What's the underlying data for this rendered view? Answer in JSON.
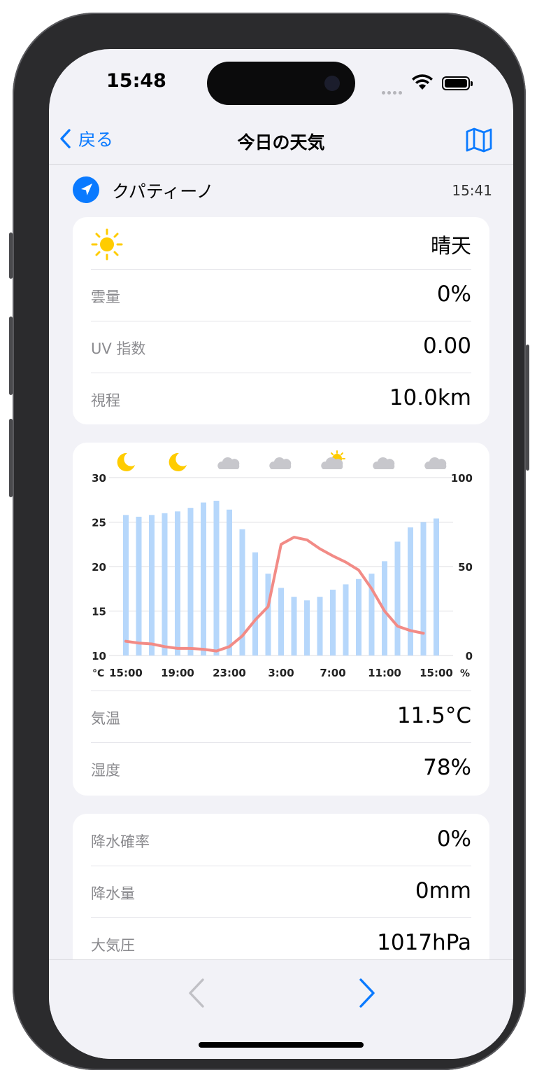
{
  "status": {
    "time": "15:48"
  },
  "nav": {
    "back_label": "戻る",
    "title": "今日の天気"
  },
  "location": {
    "name": "クパティーノ",
    "updated": "15:41"
  },
  "current": {
    "condition": "晴天",
    "rows": [
      {
        "label": "雲量",
        "value": "0%"
      },
      {
        "label": "UV 指数",
        "value": "0.00"
      },
      {
        "label": "視程",
        "value": "10.0km"
      }
    ]
  },
  "chart_data": {
    "type": "bar",
    "left_axis": {
      "unit": "°C",
      "ticks": [
        "30",
        "25",
        "20",
        "15",
        "10"
      ],
      "ylim": [
        10,
        30
      ]
    },
    "right_axis": {
      "unit": "%",
      "ticks": [
        "100",
        "50",
        "0"
      ],
      "ylim": [
        0,
        100
      ]
    },
    "x_tick_labels": [
      "15:00",
      "19:00",
      "23:00",
      "3:00",
      "7:00",
      "11:00",
      "15:00"
    ],
    "weather_icons": [
      "moon-icon",
      "moon-icon",
      "cloud-icon",
      "cloud-icon",
      "partly-sunny-icon",
      "cloud-icon",
      "cloud-icon"
    ],
    "hours": [
      "15:00",
      "16:00",
      "17:00",
      "18:00",
      "19:00",
      "20:00",
      "21:00",
      "22:00",
      "23:00",
      "0:00",
      "1:00",
      "2:00",
      "3:00",
      "4:00",
      "5:00",
      "6:00",
      "7:00",
      "8:00",
      "9:00",
      "10:00",
      "11:00",
      "12:00",
      "13:00",
      "14:00",
      "15:00"
    ],
    "series": [
      {
        "axis": "right",
        "color": "#b6d7fb",
        "values": [
          79,
          78,
          79,
          80,
          81,
          83,
          86,
          87,
          82,
          71,
          58,
          46,
          38,
          33,
          31,
          33,
          37,
          40,
          43,
          46,
          53,
          64,
          72,
          75,
          77
        ]
      },
      {
        "axis": "left",
        "color": "#f28b86",
        "values": [
          11.6,
          11.4,
          11.3,
          11.0,
          10.8,
          10.8,
          10.7,
          10.5,
          11.0,
          12.2,
          14.0,
          15.5,
          22.5,
          23.3,
          23.0,
          22.0,
          21.2,
          20.5,
          19.6,
          17.5,
          15.0,
          13.3,
          12.8,
          12.5,
          null
        ]
      }
    ]
  },
  "conditions": {
    "rows": [
      {
        "label": "気温",
        "value": "11.5°C"
      },
      {
        "label": "湿度",
        "value": "78%"
      }
    ]
  },
  "precip": {
    "rows": [
      {
        "label": "降水確率",
        "value": "0%"
      },
      {
        "label": "降水量",
        "value": "0mm"
      },
      {
        "label": "大気圧",
        "value": "1017hPa"
      }
    ]
  },
  "colors": {
    "accent": "#0a7aff",
    "sun": "#ffcc00",
    "cloud": "#c7c7cc"
  }
}
